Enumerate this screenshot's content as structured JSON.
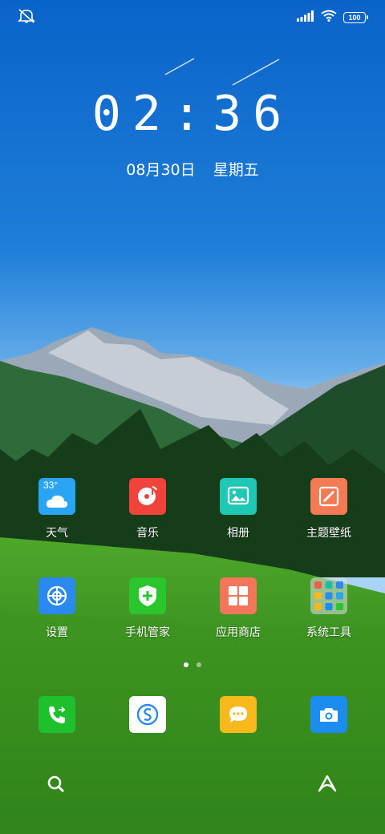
{
  "status_bar": {
    "battery": "100",
    "icons": [
      "mute-icon",
      "signal-icon",
      "wifi-icon",
      "battery-icon"
    ]
  },
  "clock": {
    "time": "02:36",
    "date": "08月30日",
    "weekday": "星期五"
  },
  "apps_row1": [
    {
      "label": "天气",
      "icon": "weather-icon",
      "color": "#2aa5f5",
      "temp": "33°"
    },
    {
      "label": "音乐",
      "icon": "music-icon",
      "color": "#f0443a"
    },
    {
      "label": "相册",
      "icon": "gallery-icon",
      "color": "#1fc7b5"
    },
    {
      "label": "主题壁纸",
      "icon": "theme-icon",
      "color": "#f47a55"
    }
  ],
  "apps_row2": [
    {
      "label": "设置",
      "icon": "settings-icon",
      "color": "#2a8af2"
    },
    {
      "label": "手机管家",
      "icon": "security-icon",
      "color": "#2bc62b"
    },
    {
      "label": "应用商店",
      "icon": "appstore-icon",
      "color": "#f4765a"
    },
    {
      "label": "系统工具",
      "icon": "folder-icon",
      "color": "#e8e8e8"
    }
  ],
  "dock": [
    {
      "icon": "phone-icon",
      "color": "#1fc02e"
    },
    {
      "icon": "browser-icon",
      "color": "#ffffff"
    },
    {
      "icon": "messages-icon",
      "color": "#f6b81a"
    },
    {
      "icon": "camera-icon",
      "color": "#1d8cf0"
    }
  ],
  "page_indicator": {
    "current": 1,
    "total": 2
  }
}
